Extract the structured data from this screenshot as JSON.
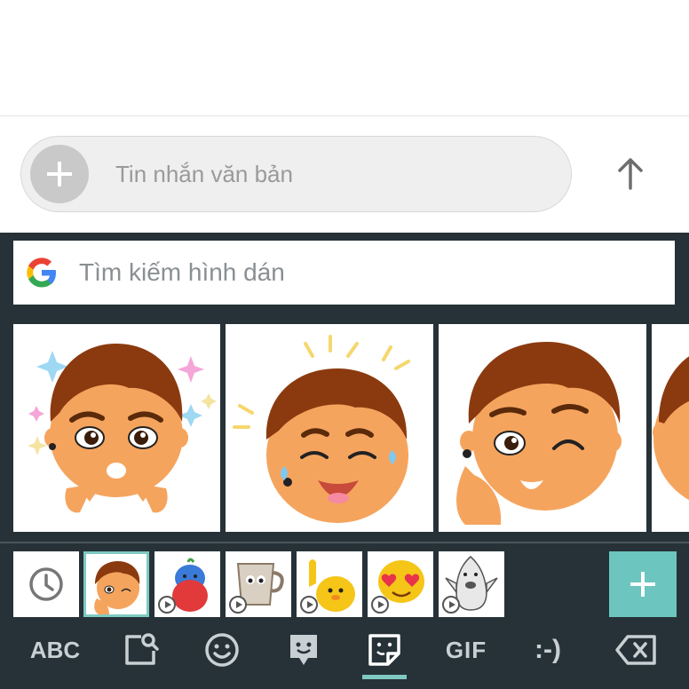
{
  "compose": {
    "placeholder": "Tin nhắn văn bản"
  },
  "icons": {
    "attach": "plus-icon",
    "send": "arrow-up-icon",
    "search": "google-g-logo",
    "recent": "clock-icon",
    "add": "plus-icon",
    "delete": "backspace-icon"
  },
  "keyboard": {
    "search_placeholder": "Tìm kiếm hình dán",
    "bottom_nav": {
      "abc_label": "ABC",
      "gif_label": "GIF",
      "emoticon_label": ":-)"
    },
    "sticker_packs": [
      "recent",
      "boy-pack",
      "blue-bird-pack",
      "coffee-cup-pack",
      "blob-pack",
      "emoji-heart-eyes-pack",
      "shark-pack"
    ],
    "selected_pack": "boy-pack",
    "active_tab": "stickers"
  },
  "colors": {
    "keyboard_bg": "#263238",
    "accent": "#6cc5be",
    "skin": "#f5a45e",
    "hair": "#8b3a0f"
  }
}
